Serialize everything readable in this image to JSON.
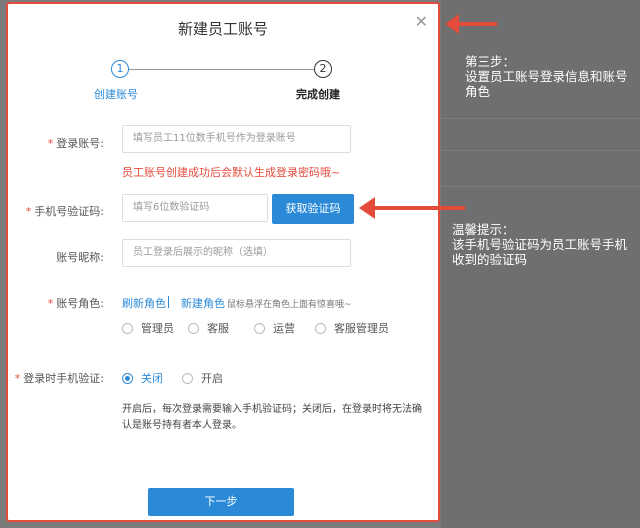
{
  "modal": {
    "title": "新建员工账号",
    "close_icon": "close-icon",
    "steps": [
      {
        "number": "1",
        "label": "创建账号",
        "state": "active"
      },
      {
        "number": "2",
        "label": "完成创建",
        "state": "pending"
      }
    ]
  },
  "form": {
    "login_account": {
      "required": "*",
      "label": "登录账号:",
      "placeholder": "填写员工11位数手机号作为登录账号",
      "hint": "员工账号创建成功后会默认生成登录密码哦~"
    },
    "phone_code": {
      "required": "*",
      "label": "手机号验证码:",
      "placeholder": "填写6位数验证码",
      "button": "获取验证码"
    },
    "nickname": {
      "label": "账号昵称:",
      "placeholder": "员工登录后展示的昵称（选填）"
    },
    "role": {
      "required": "*",
      "label": "账号角色:",
      "refresh_link": "刷新角色",
      "new_link": "新建角色",
      "tip": "鼠标悬浮在角色上面有惊喜哦~",
      "options": [
        "管理员",
        "客服",
        "运营",
        "客服管理员"
      ]
    },
    "login_verify": {
      "required": "*",
      "label": "登录时手机验证:",
      "options": [
        {
          "label": "关闭",
          "checked": true
        },
        {
          "label": "开启",
          "checked": false
        }
      ],
      "description": "开启后，每次登录需要输入手机验证码；关闭后，在登录时将无法确认是账号持有者本人登录。"
    },
    "next_button": "下一步"
  },
  "annotations": {
    "note1": "第三步：\n设置员工账号登录信息和账号角色",
    "note2": "温馨提示：\n该手机号验证码为员工账号手机收到的验证码"
  },
  "colors": {
    "accent": "#2b8ad8",
    "highlight": "#e44b3c"
  }
}
